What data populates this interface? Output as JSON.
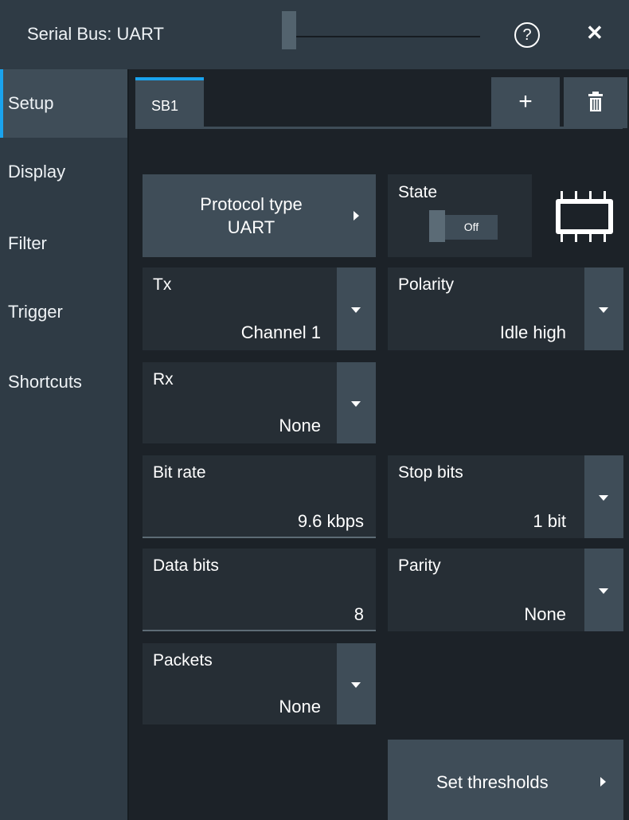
{
  "header": {
    "title": "Serial Bus: UART",
    "help_icon": "question-circle-icon",
    "close_icon": "close-icon",
    "close_symbol": "✕"
  },
  "sidebar": {
    "items": [
      {
        "label": "Setup",
        "active": true
      },
      {
        "label": "Display",
        "active": false
      },
      {
        "label": "Filter",
        "active": false
      },
      {
        "label": "Trigger",
        "active": false
      },
      {
        "label": "Shortcuts",
        "active": false
      }
    ]
  },
  "tabs": {
    "items": [
      {
        "label": "SB1",
        "active": true
      }
    ],
    "add_symbol": "+",
    "delete_icon": "trash-icon"
  },
  "setup": {
    "protocol": {
      "label": "Protocol type",
      "value": "UART"
    },
    "state": {
      "label": "State",
      "value": "Off"
    },
    "tx": {
      "label": "Tx",
      "value": "Channel 1"
    },
    "polarity": {
      "label": "Polarity",
      "value": "Idle high"
    },
    "rx": {
      "label": "Rx",
      "value": "None"
    },
    "bit_rate": {
      "label": "Bit rate",
      "value": "9.6 kbps"
    },
    "stop_bits": {
      "label": "Stop bits",
      "value": "1 bit"
    },
    "data_bits": {
      "label": "Data bits",
      "value": "8"
    },
    "parity": {
      "label": "Parity",
      "value": "None"
    },
    "packets": {
      "label": "Packets",
      "value": "None"
    },
    "set_thresholds": {
      "label": "Set thresholds"
    }
  },
  "colors": {
    "accent": "#1aa3ee",
    "background": "#1c2228",
    "panel": "#262e35",
    "control": "#3f4d58",
    "header": "#2f3b45"
  }
}
